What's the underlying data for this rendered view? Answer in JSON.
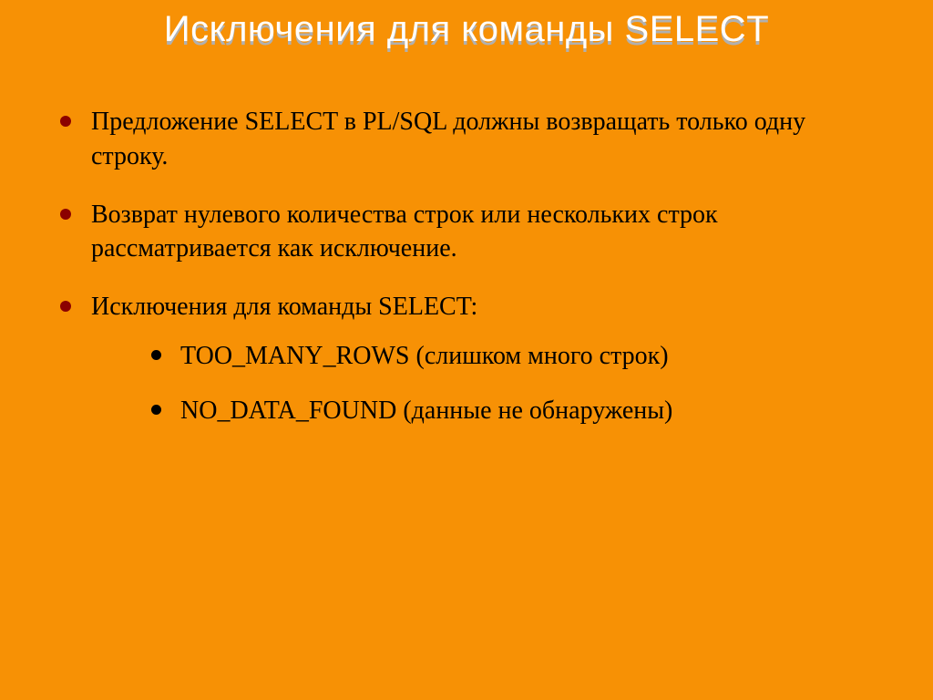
{
  "title": "Исключения для команды SELECT",
  "bullets": {
    "b1": "Предложение SELECT в PL/SQL должны возвращать только одну строку.",
    "b2": "Возврат нулевого количества строк или нескольких строк рассматривается как исключение.",
    "b3": "Исключения для команды SELECT:",
    "sub1": "TOO_MANY_ROWS (слишком много строк)",
    "sub2": "NO_DATA_FOUND (данные не обнаружены)"
  }
}
